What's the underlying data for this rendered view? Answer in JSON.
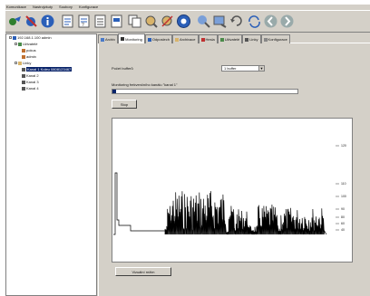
{
  "menu": [
    "Komunikace",
    "Nastrojvkuty",
    "Soubory",
    "Konfigurace"
  ],
  "toolbar_icons": [
    "connect-icon",
    "disconnect-icon",
    "info-icon",
    "doc1-icon",
    "doc2-icon",
    "doc3-icon",
    "doc4-icon",
    "copy-icon",
    "add-icon",
    "remove-icon",
    "monitor-icon",
    "graph-icon",
    "export-icon",
    "undo-icon",
    "refresh-icon",
    "back-icon",
    "forward-icon"
  ],
  "tree": {
    "root": "192.168.1.100 admin",
    "users_group": "Uživatelé",
    "user1": "pokus",
    "user2": "admin",
    "links_group": "Linky",
    "kanal1": "Kanal 1 Koleu 0808123467",
    "kanal2": "Kanal 2",
    "kanal3": "Kanal 3",
    "kanal4": "Kanal 4"
  },
  "tabs": [
    "Archiv",
    "Monitoring",
    "Odposlech",
    "Archivace",
    "Hesla",
    "Uživatelé",
    "Linky",
    "Konfigurace"
  ],
  "active_tab": "Monitoring",
  "form": {
    "buffer_label": "Počet bufferů",
    "buffer_value": "1 buffer",
    "monitor_label": "Monitoring frekvenčního kanálu \"kanal 1\"",
    "progress": 0.02,
    "stop_label": "Stop",
    "visual_label": "Vizuální režim"
  },
  "colors": {
    "chart_line": "#000000",
    "selection": "#0a246a",
    "panel": "#d4d0c8"
  },
  "chart_data": {
    "type": "bar",
    "y_ticks": [
      {
        "label": "120",
        "value": 120
      },
      {
        "label": "110",
        "value": 110
      },
      {
        "label": "100",
        "value": 100
      },
      {
        "label": "90",
        "value": 90
      },
      {
        "label": "80",
        "value": 80
      },
      {
        "label": "60",
        "value": 60
      },
      {
        "label": "40",
        "value": 40
      }
    ]
  }
}
